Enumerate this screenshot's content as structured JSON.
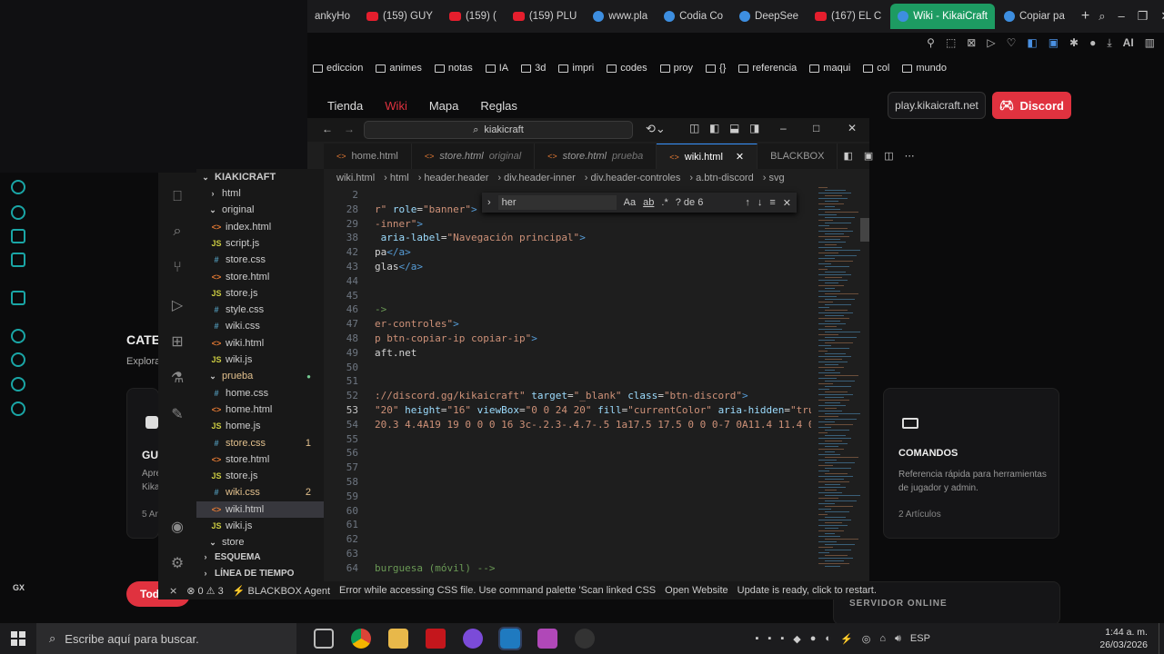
{
  "browser": {
    "tabs": [
      {
        "label": "ankyHo",
        "icon": "none"
      },
      {
        "label": "(159) GUY",
        "icon": "youtube"
      },
      {
        "label": "(159) (",
        "icon": "youtube"
      },
      {
        "label": "(159) PLU",
        "icon": "youtube"
      },
      {
        "label": "www.pla",
        "icon": "globe"
      },
      {
        "label": "Codia Co",
        "icon": "globe"
      },
      {
        "label": "DeepSee",
        "icon": "globe"
      },
      {
        "label": "(167) EL C",
        "icon": "youtube"
      },
      {
        "label": "Wiki - KikaiCraft",
        "icon": "globe",
        "active": true
      },
      {
        "label": "Copiar pa",
        "icon": "globe"
      }
    ],
    "new_tab": "+",
    "ai_label": "AI",
    "bookmarks": [
      "ediccion",
      "animes",
      "notas",
      "IA",
      "3d",
      "impri",
      "codes",
      "proy",
      "{}",
      "referencia",
      "maqui",
      "col",
      "mundo"
    ]
  },
  "site": {
    "nav": [
      "Tienda",
      "Wiki",
      "Mapa",
      "Reglas"
    ],
    "ip_button": "play.kikaicraft.net",
    "discord_button": "Discord",
    "section_title_partial": "CATE",
    "section_sub_partial": "Explora",
    "card_left": {
      "title": "GU",
      "line1": "Apre",
      "line2": "Kika",
      "count": "5 Ar"
    },
    "card_right": {
      "title": "COMANDOS",
      "desc": "Referencia rápida para herramientas de jugador y admin.",
      "count": "2 Artículos"
    },
    "all_button": "Tod",
    "server_online": "SERVIDOR ONLINE"
  },
  "vscode": {
    "search_text": "kiakicraft",
    "tabs": [
      {
        "file": "home.html",
        "sub": ""
      },
      {
        "file": "store.html",
        "sub": "original"
      },
      {
        "file": "store.html",
        "sub": "prueba"
      },
      {
        "file": "wiki.html",
        "sub": "",
        "active": true
      },
      {
        "file": "BLACKBOX",
        "sub": ""
      }
    ],
    "breadcrumbs": [
      "wiki.html",
      "html",
      "header.header",
      "div.header-inner",
      "div.header-controles",
      "a.btn-discord",
      "svg"
    ],
    "explorer": {
      "root": "KIAKICRAFT",
      "items": [
        {
          "name": "html",
          "type": "folder",
          "indent": 1
        },
        {
          "name": "original",
          "type": "folder-open",
          "indent": 1
        },
        {
          "name": "index.html",
          "type": "html",
          "indent": 2
        },
        {
          "name": "script.js",
          "type": "js",
          "indent": 2
        },
        {
          "name": "store.css",
          "type": "css",
          "indent": 2
        },
        {
          "name": "store.html",
          "type": "html",
          "indent": 2
        },
        {
          "name": "store.js",
          "type": "js",
          "indent": 2
        },
        {
          "name": "style.css",
          "type": "css",
          "indent": 2
        },
        {
          "name": "wiki.css",
          "type": "css",
          "indent": 2
        },
        {
          "name": "wiki.html",
          "type": "html",
          "indent": 2
        },
        {
          "name": "wiki.js",
          "type": "js",
          "indent": 2
        },
        {
          "name": "prueba",
          "type": "folder-open",
          "indent": 1,
          "color": "#e2c08d",
          "dot": true
        },
        {
          "name": "home.css",
          "type": "css",
          "indent": 2
        },
        {
          "name": "home.html",
          "type": "html",
          "indent": 2
        },
        {
          "name": "home.js",
          "type": "js",
          "indent": 2
        },
        {
          "name": "store.css",
          "type": "css",
          "indent": 2,
          "color": "#e2c08d",
          "count": "1"
        },
        {
          "name": "store.html",
          "type": "html",
          "indent": 2
        },
        {
          "name": "store.js",
          "type": "js",
          "indent": 2
        },
        {
          "name": "wiki.css",
          "type": "css",
          "indent": 2,
          "color": "#e2c08d",
          "count": "2"
        },
        {
          "name": "wiki.html",
          "type": "html",
          "indent": 2,
          "selected": true
        },
        {
          "name": "wiki.js",
          "type": "js",
          "indent": 2
        },
        {
          "name": "store",
          "type": "folder-open",
          "indent": 1
        }
      ],
      "outline": "ESQUEMA",
      "timeline": "LÍNEA DE TIEMPO"
    },
    "find": {
      "query": "her",
      "result": "? de 6",
      "case": "Aa",
      "word": "ab",
      "regex": ".*"
    },
    "lines": [
      {
        "n": "2",
        "html": ""
      },
      {
        "n": "28",
        "html": "<span class=\"st\">r\"</span> <span class=\"at\">role</span>=<span class=\"st\">\"banner\"</span><span class=\"tg\">&gt;</span>"
      },
      {
        "n": "29",
        "html": "<span class=\"st\">-inner\"</span><span class=\"tg\">&gt;</span>"
      },
      {
        "n": "38",
        "html": " <span class=\"at\">aria-label</span>=<span class=\"st\">\"Navegación principal\"</span><span class=\"tg\">&gt;</span>"
      },
      {
        "n": "42",
        "html": "pa<span class=\"tg\">&lt;/a&gt;</span>"
      },
      {
        "n": "43",
        "html": "glas<span class=\"tg\">&lt;/a&gt;</span>"
      },
      {
        "n": "44",
        "html": ""
      },
      {
        "n": "45",
        "html": ""
      },
      {
        "n": "46",
        "html": "<span class=\"cm\">-&gt;</span>"
      },
      {
        "n": "47",
        "html": "<span class=\"st\">er-controles\"</span><span class=\"tg\">&gt;</span>"
      },
      {
        "n": "48",
        "html": "<span class=\"st\">p btn-copiar-ip copiar-ip\"</span><span class=\"tg\">&gt;</span>"
      },
      {
        "n": "49",
        "html": "aft.net"
      },
      {
        "n": "50",
        "html": ""
      },
      {
        "n": "51",
        "html": ""
      },
      {
        "n": "52",
        "html": "<span class=\"st\">://discord.gg/kikaicraft\"</span> <span class=\"at\">target</span>=<span class=\"st\">\"_blank\"</span> <span class=\"at\">class</span>=<span class=\"st\">\"btn-discord\"</span><span class=\"tg\">&gt;</span>"
      },
      {
        "n": "53",
        "html": "<span class=\"st\">\"20\"</span> <span class=\"at\">height</span>=<span class=\"st\">\"16\"</span> <span class=\"at\">viewBox</span>=<span class=\"st\">\"0 0 24 20\"</span> <span class=\"at\">fill</span>=<span class=\"st\">\"currentColor\"</span> <span class=\"at\">aria-hidden</span>=<span class=\"st\">\"true\"</span>"
      },
      {
        "n": "54",
        "html": "<span class=\"st\">20.3 4.4A19 19 0 0 0 16 3c-.2.3-.4.7-.5 1a17.5 17.5 0 0 0-7 0A11.4 11.4 0 0</span>"
      },
      {
        "n": "55",
        "html": ""
      },
      {
        "n": "56",
        "html": ""
      },
      {
        "n": "57",
        "html": ""
      },
      {
        "n": "58",
        "html": ""
      },
      {
        "n": "59",
        "html": ""
      },
      {
        "n": "60",
        "html": ""
      },
      {
        "n": "61",
        "html": ""
      },
      {
        "n": "62",
        "html": ""
      },
      {
        "n": "63",
        "html": ""
      },
      {
        "n": "64",
        "html": "<span class=\"cm\">burguesa (móvil) --&gt;</span>"
      }
    ],
    "status": {
      "errors": "0",
      "warnings": "3",
      "agent": "BLACKBOX Agent",
      "message": "Error while accessing CSS file. Use command palette 'Scan linked CSS",
      "open_website": "Open Website",
      "update": "Update is ready, click to restart."
    }
  },
  "taskbar": {
    "search_placeholder": "Escribe aquí para buscar.",
    "lang": "ESP",
    "time": "1:44 a. m.",
    "date": "26/03/2026"
  },
  "sidebar_left": {
    "gx_label": "GX"
  }
}
